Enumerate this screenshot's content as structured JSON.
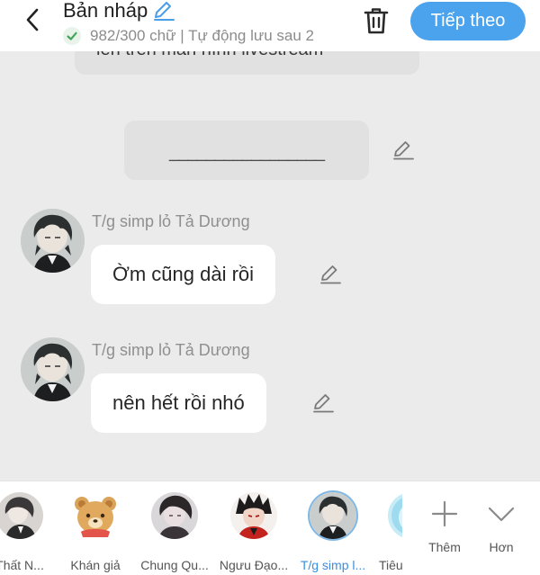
{
  "header": {
    "title": "Bản nháp",
    "subtitle": "982/300 chữ | Tự động lưu sau 2",
    "next_label": "Tiếp theo"
  },
  "chat": {
    "partial_text": "lên trên màn hình livestream",
    "divider_text": "_________________",
    "messages": [
      {
        "sender": "T/g simp lỏ Tả Dương",
        "text": "Ờm cũng dài rồi"
      },
      {
        "sender": "T/g simp lỏ Tả Dương",
        "text": "nên hết rồi nhó"
      }
    ]
  },
  "characters": [
    {
      "label": "Thất N...",
      "icon": "character-avatar-thatn"
    },
    {
      "label": "Khán giả",
      "icon": "bear-avatar"
    },
    {
      "label": "Chung Qu...",
      "icon": "character-avatar-chungqu"
    },
    {
      "label": "Ngưu Đạo...",
      "icon": "character-avatar-nguudao"
    },
    {
      "label": "T/g simp l...",
      "icon": "character-avatar-tgsimp",
      "selected": true
    },
    {
      "label": "Tiêu",
      "icon": "character-avatar-tieu"
    }
  ],
  "tools": {
    "add_label": "Thêm",
    "more_label": "Hơn"
  },
  "colors": {
    "accent": "#4aa3ec",
    "active_label": "#3b8ee0",
    "background": "#ebebeb",
    "bubble_gray": "#e1e1e1"
  }
}
